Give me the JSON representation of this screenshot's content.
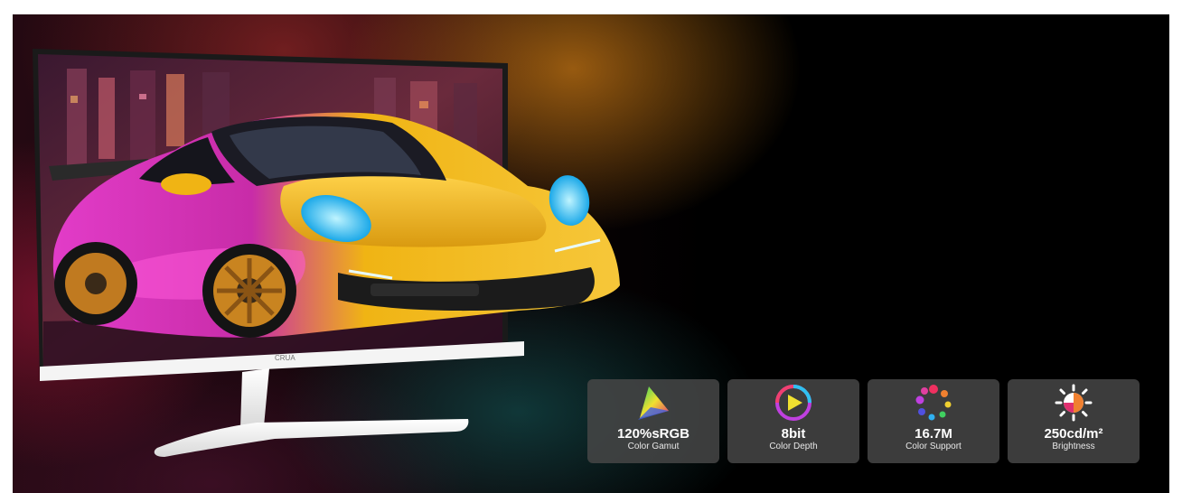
{
  "brand": {
    "logo_text": "CRUA"
  },
  "colors": {
    "badge_bg": "#464646",
    "car_yellow": "#f0b414",
    "car_magenta": "#e23cc8",
    "headlight_cyan": "#39d4ff",
    "monitor_white": "#f4f4f4"
  },
  "features": [
    {
      "icon": "color-gamut-icon",
      "value": "120%sRGB",
      "label": "Color Gamut"
    },
    {
      "icon": "color-depth-icon",
      "value": "8bit",
      "label": "Color Depth"
    },
    {
      "icon": "color-support-icon",
      "value": "16.7M",
      "label": "Color Support"
    },
    {
      "icon": "brightness-icon",
      "value": "250cd/m²",
      "label": "Brightness"
    }
  ]
}
